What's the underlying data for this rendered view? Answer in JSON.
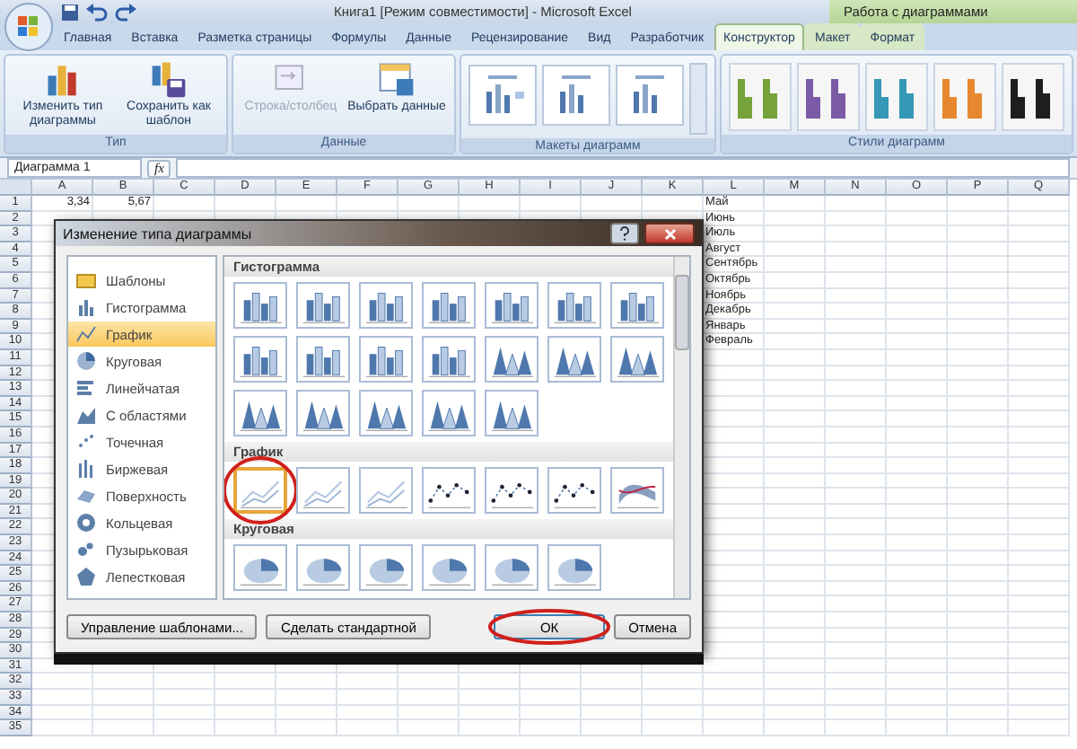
{
  "window": {
    "title": "Книга1  [Режим совместимости] - Microsoft Excel",
    "context_title": "Работа с диаграммами"
  },
  "tabs": [
    {
      "label": "Главная",
      "selected": false,
      "context": false
    },
    {
      "label": "Вставка",
      "selected": false,
      "context": false
    },
    {
      "label": "Разметка страницы",
      "selected": false,
      "context": false
    },
    {
      "label": "Формулы",
      "selected": false,
      "context": false
    },
    {
      "label": "Данные",
      "selected": false,
      "context": false
    },
    {
      "label": "Рецензирование",
      "selected": false,
      "context": false
    },
    {
      "label": "Вид",
      "selected": false,
      "context": false
    },
    {
      "label": "Разработчик",
      "selected": false,
      "context": false
    },
    {
      "label": "Конструктор",
      "selected": true,
      "context": true
    },
    {
      "label": "Макет",
      "selected": false,
      "context": true
    },
    {
      "label": "Формат",
      "selected": false,
      "context": true
    }
  ],
  "ribbon": {
    "groups": [
      {
        "label": "Тип",
        "kind": "buttons",
        "buttons": [
          {
            "label": "Изменить тип диаграммы",
            "disabled": false
          },
          {
            "label": "Сохранить как шаблон",
            "disabled": false
          }
        ]
      },
      {
        "label": "Данные",
        "kind": "buttons",
        "buttons": [
          {
            "label": "Строка/столбец",
            "disabled": true
          },
          {
            "label": "Выбрать данные",
            "disabled": false
          }
        ]
      },
      {
        "label": "Макеты диаграмм",
        "kind": "layouts"
      },
      {
        "label": "Стили диаграмм",
        "kind": "styles",
        "styles": [
          {
            "color": "#76a23c"
          },
          {
            "color": "#7b5aa6"
          },
          {
            "color": "#3598b5"
          },
          {
            "color": "#e8882e"
          },
          {
            "color": "#1e1e1e"
          }
        ]
      }
    ]
  },
  "formula_bar": {
    "name_box": "Диаграмма 1",
    "function_label": "fx"
  },
  "sheet": {
    "columns": [
      "A",
      "B",
      "C",
      "D",
      "E",
      "F",
      "G",
      "H",
      "I",
      "J",
      "K",
      "L",
      "M",
      "N",
      "O",
      "P",
      "Q"
    ],
    "rows": [
      {
        "number": "1",
        "column_a": "3,34",
        "column_b": "5,67",
        "column_l": "Май"
      },
      {
        "number": "2",
        "column_l": "Июнь"
      },
      {
        "number": "3",
        "column_l": "Июль"
      },
      {
        "number": "4",
        "column_l": "Август"
      },
      {
        "number": "5",
        "column_l": "Сентябрь"
      },
      {
        "number": "6",
        "column_l": "Октябрь"
      },
      {
        "number": "7",
        "column_l": "Ноябрь"
      },
      {
        "number": "8",
        "column_l": "Декабрь"
      },
      {
        "number": "9",
        "column_l": "Январь"
      },
      {
        "number": "10",
        "column_l": "Февраль"
      },
      {
        "number": "11"
      },
      {
        "number": "12"
      },
      {
        "number": "13"
      },
      {
        "number": "14"
      },
      {
        "number": "15"
      },
      {
        "number": "16"
      },
      {
        "number": "17"
      },
      {
        "number": "18"
      },
      {
        "number": "19"
      },
      {
        "number": "20"
      },
      {
        "number": "21"
      },
      {
        "number": "22"
      },
      {
        "number": "23"
      },
      {
        "number": "24"
      },
      {
        "number": "25"
      },
      {
        "number": "26"
      },
      {
        "number": "27"
      },
      {
        "number": "28"
      },
      {
        "number": "29"
      },
      {
        "number": "30"
      },
      {
        "number": "31"
      },
      {
        "number": "32"
      },
      {
        "number": "33"
      },
      {
        "number": "34"
      },
      {
        "number": "35"
      }
    ]
  },
  "dialog": {
    "title": "Изменение типа диаграммы",
    "categories": [
      {
        "label": "Шаблоны",
        "selected": false
      },
      {
        "label": "Гистограмма",
        "selected": false
      },
      {
        "label": "График",
        "selected": true
      },
      {
        "label": "Круговая",
        "selected": false
      },
      {
        "label": "Линейчатая",
        "selected": false
      },
      {
        "label": "С областями",
        "selected": false
      },
      {
        "label": "Точечная",
        "selected": false
      },
      {
        "label": "Биржевая",
        "selected": false
      },
      {
        "label": "Поверхность",
        "selected": false
      },
      {
        "label": "Кольцевая",
        "selected": false
      },
      {
        "label": "Пузырьковая",
        "selected": false
      },
      {
        "label": "Лепестковая",
        "selected": false
      }
    ],
    "sections": [
      {
        "heading": "Гистограмма",
        "items": [
          {
            "kind": "column",
            "selected": false
          },
          {
            "kind": "column",
            "selected": false
          },
          {
            "kind": "column",
            "selected": false
          },
          {
            "kind": "column",
            "selected": false
          },
          {
            "kind": "column",
            "selected": false
          },
          {
            "kind": "column",
            "selected": false
          },
          {
            "kind": "column",
            "selected": false
          },
          {
            "kind": "column",
            "selected": false
          },
          {
            "kind": "column",
            "selected": false
          },
          {
            "kind": "column",
            "selected": false
          },
          {
            "kind": "column",
            "selected": false
          },
          {
            "kind": "cone",
            "selected": false
          },
          {
            "kind": "cone",
            "selected": false
          },
          {
            "kind": "cone",
            "selected": false
          },
          {
            "kind": "cone",
            "selected": false
          },
          {
            "kind": "cone",
            "selected": false
          },
          {
            "kind": "cone",
            "selected": false
          },
          {
            "kind": "cone",
            "selected": false
          },
          {
            "kind": "cone",
            "selected": false
          }
        ]
      },
      {
        "heading": "График",
        "items": [
          {
            "kind": "line",
            "selected": true
          },
          {
            "kind": "line",
            "selected": false
          },
          {
            "kind": "line",
            "selected": false
          },
          {
            "kind": "markers",
            "selected": false
          },
          {
            "kind": "markers",
            "selected": false
          },
          {
            "kind": "markers",
            "selected": false
          },
          {
            "kind": "ribbon",
            "selected": false
          }
        ]
      },
      {
        "heading": "Круговая",
        "items": [
          {
            "kind": "pie",
            "selected": false
          },
          {
            "kind": "pie",
            "selected": false
          },
          {
            "kind": "pie",
            "selected": false
          },
          {
            "kind": "pie",
            "selected": false
          },
          {
            "kind": "pie",
            "selected": false
          },
          {
            "kind": "pie",
            "selected": false
          }
        ]
      }
    ],
    "buttons": [
      {
        "label": "Управление шаблонами...",
        "default": false
      },
      {
        "label": "Сделать стандартной",
        "default": false
      },
      {
        "label": "ОК",
        "default": true
      },
      {
        "label": "Отмена",
        "default": false
      }
    ]
  }
}
